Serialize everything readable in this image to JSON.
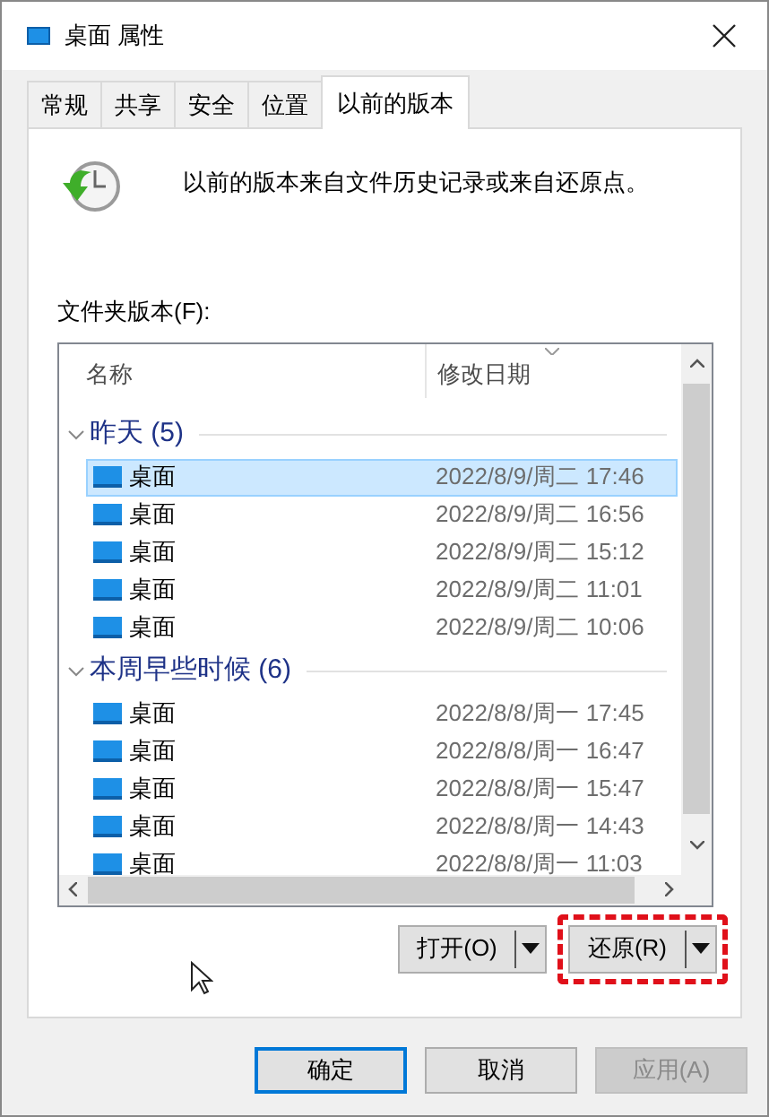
{
  "window": {
    "title": "桌面 属性"
  },
  "tabs": [
    {
      "label": "常规",
      "selected": false
    },
    {
      "label": "共享",
      "selected": false
    },
    {
      "label": "安全",
      "selected": false
    },
    {
      "label": "位置",
      "selected": false
    },
    {
      "label": "以前的版本",
      "selected": true
    }
  ],
  "description": "以前的版本来自文件历史记录或来自还原点。",
  "versions_label": "文件夹版本(F):",
  "list": {
    "columns": [
      "名称",
      "修改日期"
    ],
    "groups": [
      {
        "label": "昨天 (5)",
        "expanded": true,
        "rows": [
          {
            "name": "桌面",
            "date": "2022/8/9/周二 17:46",
            "selected": true
          },
          {
            "name": "桌面",
            "date": "2022/8/9/周二 16:56",
            "selected": false
          },
          {
            "name": "桌面",
            "date": "2022/8/9/周二 15:12",
            "selected": false
          },
          {
            "name": "桌面",
            "date": "2022/8/9/周二 11:01",
            "selected": false
          },
          {
            "name": "桌面",
            "date": "2022/8/9/周二 10:06",
            "selected": false
          }
        ]
      },
      {
        "label": "本周早些时候 (6)",
        "expanded": true,
        "rows": [
          {
            "name": "桌面",
            "date": "2022/8/8/周一 17:45",
            "selected": false
          },
          {
            "name": "桌面",
            "date": "2022/8/8/周一 16:47",
            "selected": false
          },
          {
            "name": "桌面",
            "date": "2022/8/8/周一 15:47",
            "selected": false
          },
          {
            "name": "桌面",
            "date": "2022/8/8/周一 14:43",
            "selected": false
          },
          {
            "name": "桌面",
            "date": "2022/8/8/周一 11:03",
            "selected": false
          }
        ]
      }
    ]
  },
  "actions": [
    {
      "label": "打开(O)",
      "highlighted": false
    },
    {
      "label": "还原(R)",
      "highlighted": true
    }
  ],
  "buttons": [
    {
      "label": "确定",
      "default": true,
      "disabled": false
    },
    {
      "label": "取消",
      "default": false,
      "disabled": false
    },
    {
      "label": "应用(A)",
      "default": false,
      "disabled": true
    }
  ]
}
